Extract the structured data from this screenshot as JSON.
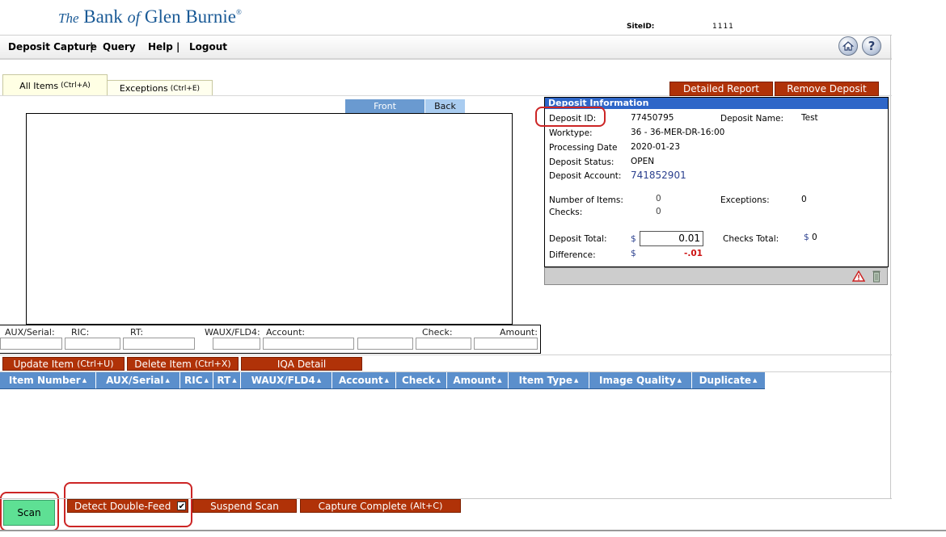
{
  "header": {
    "logo_the": "The",
    "logo_bank": " Bank ",
    "logo_of": "of",
    "logo_name": " Glen Burnie",
    "logo_reg": "®",
    "siteid_label": "SiteID:",
    "siteid_value": "1111"
  },
  "nav": {
    "items": [
      "Deposit Capture",
      "Query",
      "Help",
      "Logout"
    ],
    "separator": "|",
    "help_icon_glyph": "?",
    "icons": [
      "home-icon",
      "help-icon"
    ]
  },
  "tabs": {
    "all_items": "All Items",
    "all_items_key": "(Ctrl+A)",
    "exceptions": "Exceptions",
    "exceptions_key": "(Ctrl+E)"
  },
  "image_view": {
    "front": "Front",
    "back": "Back"
  },
  "fields": {
    "aux_serial": "AUX/Serial:",
    "ric": "RIC:",
    "rt": "RT:",
    "waux_fld4": "WAUX/FLD4:",
    "account": "Account:",
    "check": "Check:",
    "amount": "Amount:"
  },
  "item_buttons": {
    "update": "Update Item",
    "update_key": "(Ctrl+U)",
    "delete": "Delete Item",
    "delete_key": "(Ctrl+X)",
    "iqa": "IQA Detail"
  },
  "table": {
    "columns": [
      "Item Number",
      "AUX/Serial",
      "RIC",
      "RT",
      "WAUX/FLD4",
      "Account",
      "Check",
      "Amount",
      "Item Type",
      "Image Quality",
      "Duplicate"
    ],
    "sort_glyph": "▲"
  },
  "deposit_actions": {
    "detailed_report": "Detailed Report",
    "remove_deposit": "Remove Deposit"
  },
  "deposit_info": {
    "title": "Deposit Information",
    "deposit_id_label": "Deposit ID:",
    "deposit_id": "77450795",
    "deposit_name_label": "Deposit Name:",
    "deposit_name": "Test",
    "worktype_label": "Worktype:",
    "worktype": "36 - 36-MER-DR-16:00",
    "processing_date_label": "Processing Date",
    "processing_date": "2020-01-23",
    "deposit_status_label": "Deposit Status:",
    "deposit_status": "OPEN",
    "deposit_account_label": "Deposit Account:",
    "deposit_account": "741852901",
    "number_of_items_label": "Number of Items:",
    "number_of_items": "0",
    "exceptions_label": "Exceptions:",
    "exceptions": "0",
    "checks_label": "Checks:",
    "checks": "0",
    "deposit_total_label": "Deposit Total:",
    "currency": "$",
    "deposit_total": "0.01",
    "checks_total_label": "Checks Total:",
    "checks_total": "0",
    "difference_label": "Difference:",
    "difference": "-.01",
    "accent_color": "#2e66c8",
    "difference_color": "#cc1111"
  },
  "bottom": {
    "scan": "Scan",
    "detect_double_feed": "Detect Double-Feed",
    "detect_double_feed_checked": true,
    "checkmark": "✔",
    "suspend_scan": "Suspend Scan",
    "capture_complete": "Capture Complete",
    "capture_complete_key": "(Alt+C)"
  },
  "colors": {
    "red_button": "#b03208",
    "table_header": "#5b8fcc",
    "scan_button": "#5ee094",
    "annotation": "#cc2525"
  }
}
